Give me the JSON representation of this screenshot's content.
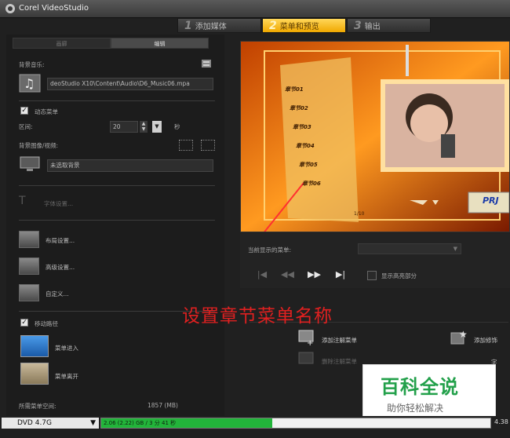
{
  "window": {
    "title": "Corel VideoStudio"
  },
  "steps": [
    {
      "num": "1",
      "label": "添加媒体"
    },
    {
      "num": "2",
      "label": "菜单和预览"
    },
    {
      "num": "3",
      "label": "输出"
    }
  ],
  "panel_tabs": [
    "画廊",
    "编辑"
  ],
  "bg_music": {
    "label": "背景音乐:",
    "path": "deoStudio X10\\Content\\Audio\\D6_Music06.mpa"
  },
  "motion_menu": {
    "label": "动态菜单",
    "checked": true
  },
  "interval": {
    "label": "区间:",
    "value": "20",
    "unit": "秒"
  },
  "bg_image": {
    "label": "背景图像/视频:",
    "value": "未选取背景"
  },
  "font_settings": "字体设置...",
  "layout_settings": "布局设置...",
  "advanced_settings": "高级设置...",
  "custom": "自定义...",
  "motion_path": {
    "label": "移动路径",
    "checked": true
  },
  "menu_enter": "菜单进入",
  "menu_leave": "菜单离开",
  "space": {
    "label": "所需菜单空间:",
    "value": "1857 (MB)"
  },
  "preview": {
    "chapters": [
      "章节01",
      "章节02",
      "章节03",
      "章节04",
      "章节05",
      "章节06"
    ],
    "page": "1/10",
    "project_badge": "PRJ"
  },
  "current_menu_label": "当前显示的菜单:",
  "show_safe_area": "显示高亮部分",
  "add_note_menu": "添加注解菜单",
  "delete_note_menu": "删除注解菜单",
  "add_decoration": "添加修饰",
  "add_text": "字",
  "annotation_text": "设置章节菜单名称",
  "disc": {
    "type": "DVD 4.7G",
    "progress_text": "2.06 (2.22) GB / 3 分 41 秒",
    "progress": 0.44,
    "capacity": "4.38"
  },
  "watermark": {
    "title": "百科全说",
    "subtitle": "助你轻松解决"
  },
  "colors": {
    "active_step": "#f0a800",
    "annotation": "#e02020",
    "progress": "#22b43a"
  }
}
